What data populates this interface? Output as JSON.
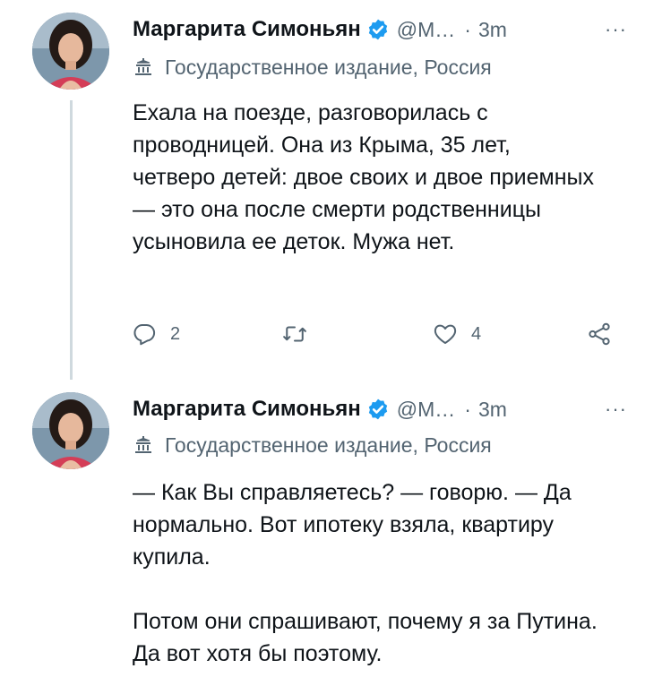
{
  "tweets": [
    {
      "author": {
        "name": "Маргарита Симоньян",
        "handle": "@М…",
        "avatar_icon": "avatar-photo"
      },
      "separator": "·",
      "time": "3m",
      "more": "···",
      "state_label": "Государственное издание, Россия",
      "paragraphs": [
        "Ехала на поезде, разговорилась с проводницей. Она из Крыма, 35 лет, четверо детей: двое своих и двое приемных — это она после смерти родственницы усыновила ее деток. Мужа нет."
      ],
      "actions": {
        "reply_count": "2",
        "retweet_count": "",
        "like_count": "4"
      }
    },
    {
      "author": {
        "name": "Маргарита Симоньян",
        "handle": "@М…",
        "avatar_icon": "avatar-photo"
      },
      "separator": "·",
      "time": "3m",
      "more": "···",
      "state_label": "Государственное издание, Россия",
      "paragraphs": [
        "— Как Вы справляетесь? — говорю. — Да нормально. Вот ипотеку взяла, квартиру купила.",
        "Потом они спрашивают, почему я за Путина. Да вот хотя бы поэтому."
      ]
    }
  ],
  "colors": {
    "accent": "#1d9bf0",
    "text": "#0f1419",
    "muted": "#536471",
    "thread_line": "#cfd9de"
  }
}
